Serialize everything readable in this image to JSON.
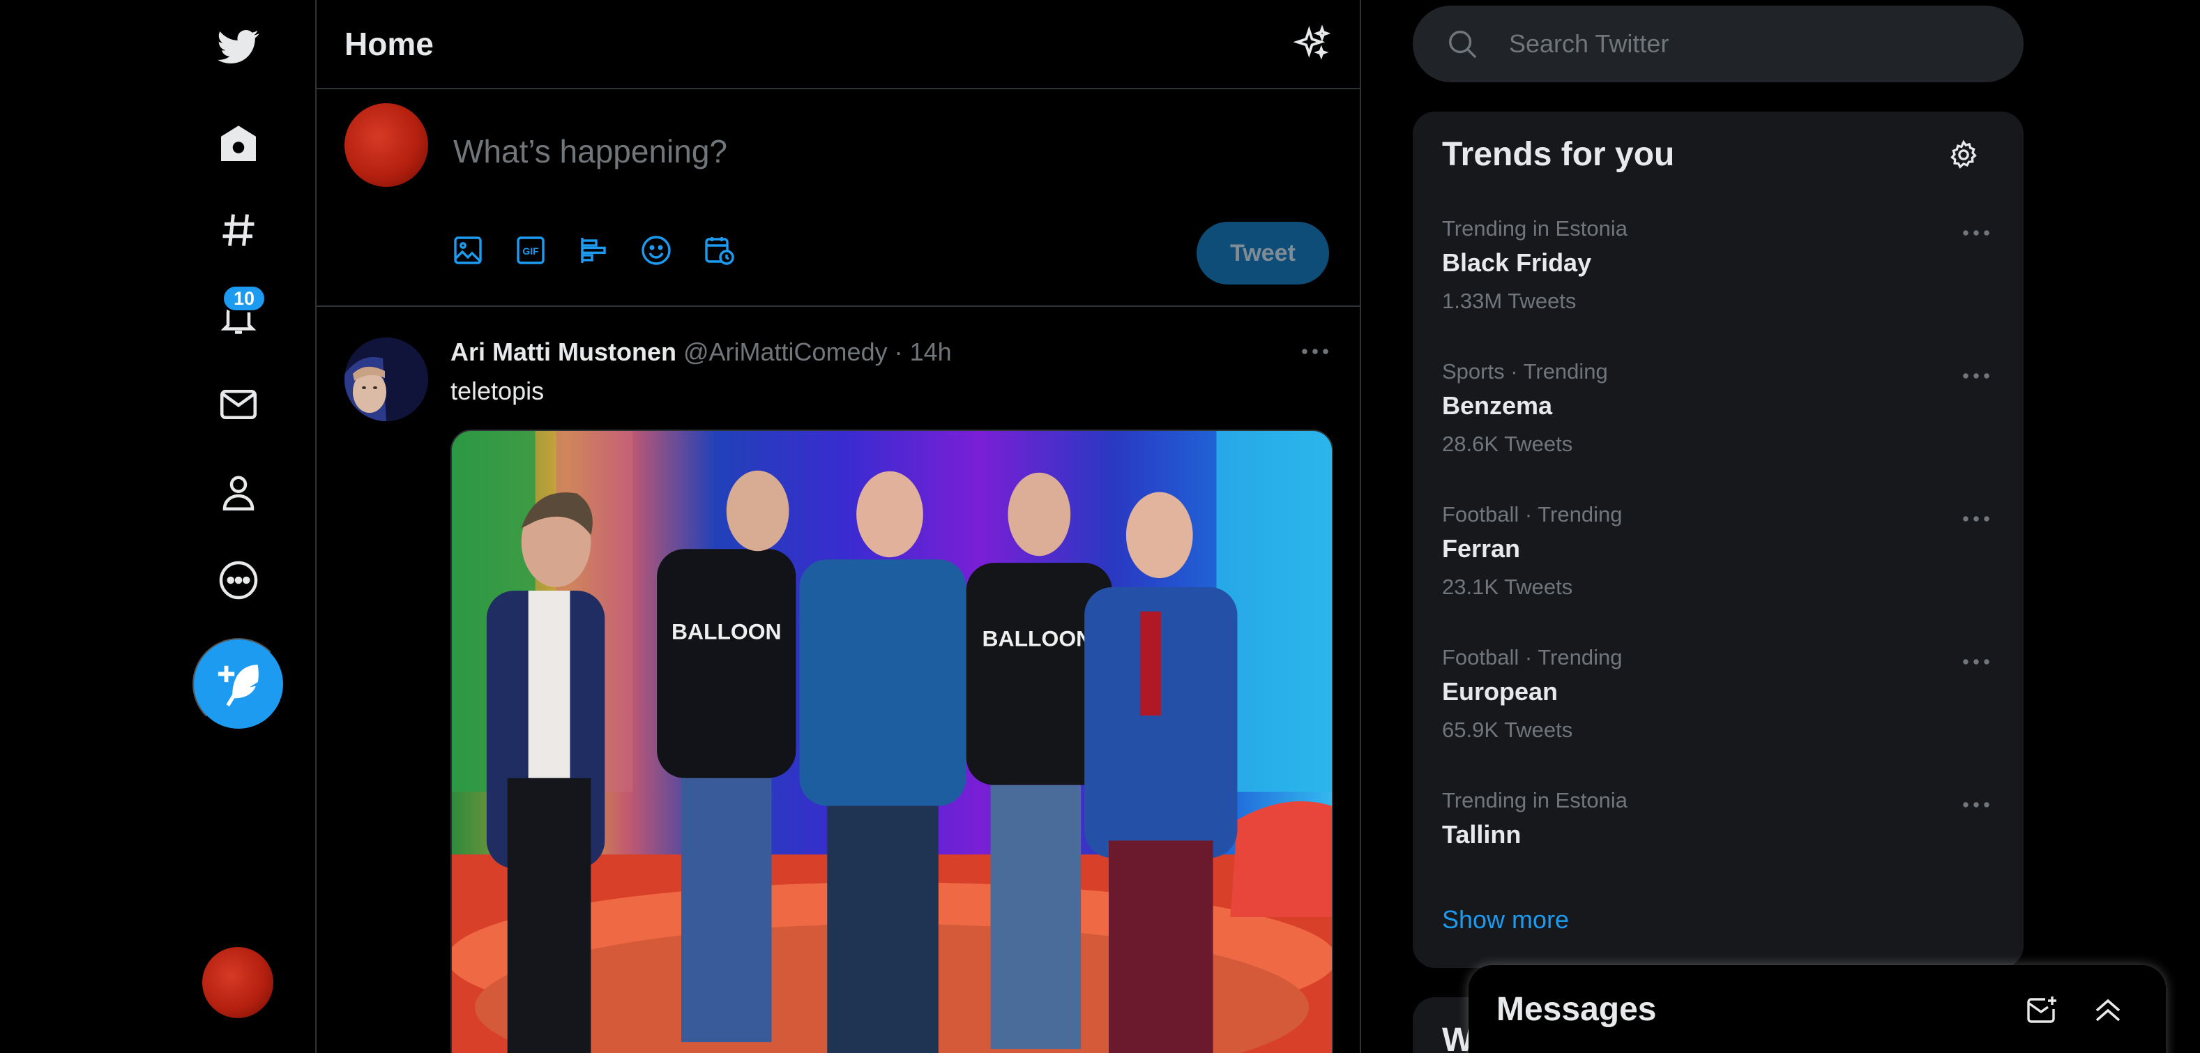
{
  "app": {
    "name": "Twitter",
    "accent": "#1d9bf0",
    "background": "#000000"
  },
  "sidebar": {
    "items": [
      {
        "name": "twitter-logo",
        "icon": "twitter-bird-icon"
      },
      {
        "name": "home",
        "icon": "home-icon"
      },
      {
        "name": "explore",
        "icon": "hashtag-icon"
      },
      {
        "name": "notifications",
        "icon": "bell-icon",
        "badge": "10"
      },
      {
        "name": "messages",
        "icon": "envelope-icon"
      },
      {
        "name": "profile",
        "icon": "person-icon"
      },
      {
        "name": "more",
        "icon": "more-circle-icon"
      }
    ],
    "compose_icon": "feather-plus-icon"
  },
  "header": {
    "title": "Home",
    "icon": "sparkle-icon"
  },
  "composer": {
    "placeholder": "What’s happening?",
    "tools": [
      "image-icon",
      "gif-icon",
      "poll-icon",
      "emoji-icon",
      "schedule-icon"
    ],
    "gif_label": "GIF",
    "tweet_label": "Tweet"
  },
  "tweet": {
    "name": "Ari Matti Mustonen",
    "handle": "@AriMattiComedy",
    "dot": "·",
    "time": "14h",
    "text": "teletopis",
    "photo_shirt_text": "BALLOON"
  },
  "search": {
    "placeholder": "Search Twitter"
  },
  "trends": {
    "title": "Trends for you",
    "items": [
      {
        "context": "Trending in Estonia",
        "name": "Black Friday",
        "count": "1.33M Tweets"
      },
      {
        "context": "Sports · Trending",
        "name": "Benzema",
        "count": "28.6K Tweets"
      },
      {
        "context": "Football · Trending",
        "name": "Ferran",
        "count": "23.1K Tweets"
      },
      {
        "context": "Football · Trending",
        "name": "European",
        "count": "65.9K Tweets"
      },
      {
        "context": "Trending in Estonia",
        "name": "Tallinn",
        "count": ""
      }
    ],
    "show_more": "Show more"
  },
  "who_to_follow": {
    "title_visible": "W"
  },
  "messages_drawer": {
    "title": "Messages"
  }
}
